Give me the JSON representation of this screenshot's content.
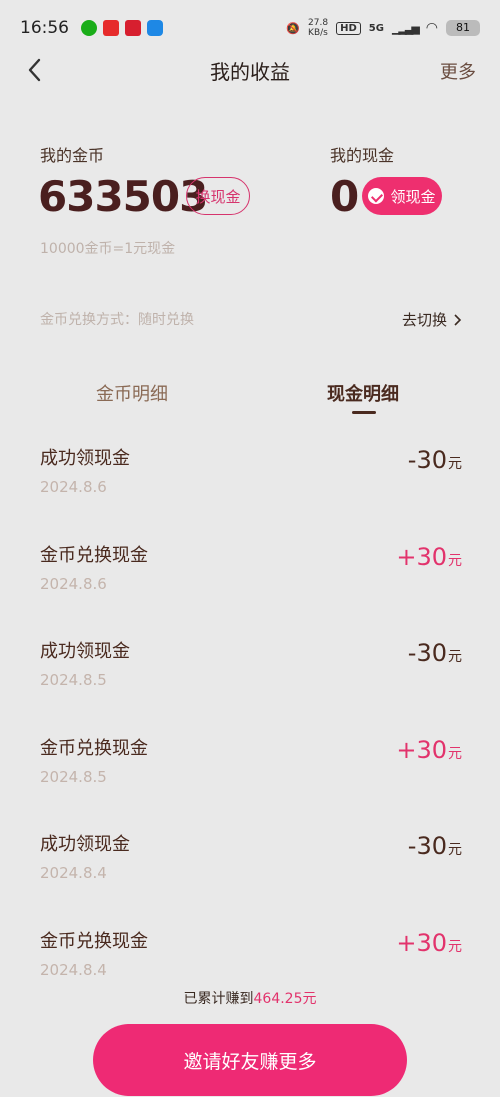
{
  "status": {
    "time": "16:56",
    "net_speed": "27.8\nKB/s",
    "hd": "HD",
    "net_type": "5G",
    "battery": "81"
  },
  "nav": {
    "title": "我的收益",
    "more": "更多"
  },
  "coins": {
    "label": "我的金币",
    "value": "633503",
    "button": "换现金"
  },
  "cash": {
    "label": "我的现金",
    "value": "0",
    "button": "领现金"
  },
  "rate_text": "10000金币=1元现金",
  "exchange": {
    "mode": "金币兑换方式：随时兑换",
    "switch": "去切换"
  },
  "tabs": {
    "coins": "金币明细",
    "cash": "现金明细"
  },
  "records": [
    {
      "title": "成功领现金",
      "date": "2024.8.6",
      "amount": "-30",
      "unit": "元"
    },
    {
      "title": "金币兑换现金",
      "date": "2024.8.6",
      "amount": "+30",
      "unit": "元"
    },
    {
      "title": "成功领现金",
      "date": "2024.8.5",
      "amount": "-30",
      "unit": "元"
    },
    {
      "title": "金币兑换现金",
      "date": "2024.8.5",
      "amount": "+30",
      "unit": "元"
    },
    {
      "title": "成功领现金",
      "date": "2024.8.4",
      "amount": "-30",
      "unit": "元"
    },
    {
      "title": "金币兑换现金",
      "date": "2024.8.4",
      "amount": "+30",
      "unit": "元"
    }
  ],
  "total": {
    "prefix": "已累计赚到",
    "amount": "464.25元"
  },
  "invite_button": "邀请好友赚更多",
  "colors": {
    "accent": "#ee2f6f",
    "background": "#e9e9e9",
    "text_dark": "#4a1f1f"
  }
}
